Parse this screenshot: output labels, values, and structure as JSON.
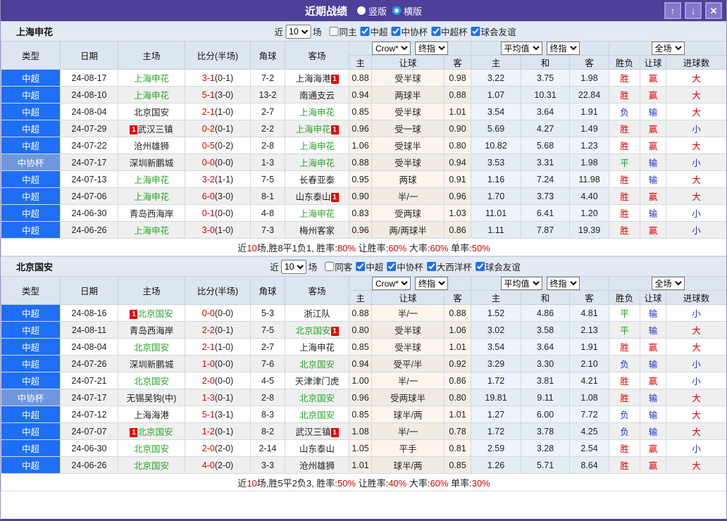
{
  "titlebar": {
    "title": "近期战绩",
    "radio_vertical": "竖版",
    "radio_horizontal": "横版",
    "up_glyph": "↑",
    "down_glyph": "↓",
    "close_glyph": "✕"
  },
  "colors": {
    "titlebar_bg": "#4c4099",
    "csl_type_bg": "#1e6ff5",
    "cup_type_bg": "#6f97df",
    "team_highlight_green": "#2ba52b",
    "score_red": "#e00000",
    "rank_badge_bg": "#e60000",
    "avg_col_bg": "#ecf5fb",
    "odds_col_bg": "#fdf5ec",
    "radio_ring_blue": "#1e9ce8"
  },
  "result_colors": {
    "胜": "#e00000",
    "平": "#1fa11f",
    "负": "#2233cc",
    "赢": "#e00000",
    "输": "#2233cc",
    "大": "#e00000",
    "小": "#2233cc"
  },
  "header": {
    "left_cols": [
      "类型",
      "日期",
      "主场",
      "比分(半场)",
      "角球",
      "客场"
    ],
    "sub_cols": [
      "主",
      "让球",
      "客",
      "主",
      "和",
      "客",
      "胜负",
      "让球",
      "进球数"
    ],
    "dropdowns": {
      "bookmaker": "Crow*",
      "odds_stage": "终指",
      "average": "平均值",
      "avg_stage": "终指",
      "scope": "全场"
    }
  },
  "sections": [
    {
      "team": "上海申花",
      "slug": "shenhua",
      "filter": {
        "near_label": "近",
        "near_value": "10",
        "games_label": "场",
        "same_label": "同主",
        "same_checked": false,
        "cups": [
          {
            "label": "中超",
            "checked": true
          },
          {
            "label": "中协杯",
            "checked": true
          },
          {
            "label": "中超杯",
            "checked": true
          },
          {
            "label": "球会友谊",
            "checked": true
          }
        ]
      },
      "rows": [
        {
          "type": "中超",
          "cup": false,
          "date": "24-08-17",
          "home": {
            "name": "上海申花",
            "green": true
          },
          "away": {
            "name": "上海海港",
            "green": false,
            "badge": "1",
            "badge_pos": "post"
          },
          "score": "3-1",
          "half": "(0-1)",
          "corners": "7-2",
          "odds": [
            "0.88",
            "受半球",
            "0.98"
          ],
          "avg": [
            "3.22",
            "3.75",
            "1.98"
          ],
          "results": [
            "胜",
            "赢",
            "大"
          ]
        },
        {
          "type": "中超",
          "cup": false,
          "date": "24-08-10",
          "home": {
            "name": "上海申花",
            "green": true
          },
          "away": {
            "name": "南通支云",
            "green": false
          },
          "score": "5-1",
          "half": "(3-0)",
          "corners": "13-2",
          "odds": [
            "0.94",
            "两球半",
            "0.88"
          ],
          "avg": [
            "1.07",
            "10.31",
            "22.84"
          ],
          "results": [
            "胜",
            "赢",
            "大"
          ]
        },
        {
          "type": "中超",
          "cup": false,
          "date": "24-08-04",
          "home": {
            "name": "北京国安",
            "green": false
          },
          "away": {
            "name": "上海申花",
            "green": true
          },
          "score": "2-1",
          "half": "(1-0)",
          "corners": "2-7",
          "odds": [
            "0.85",
            "受半球",
            "1.01"
          ],
          "avg": [
            "3.54",
            "3.64",
            "1.91"
          ],
          "results": [
            "负",
            "输",
            "大"
          ]
        },
        {
          "type": "中超",
          "cup": false,
          "date": "24-07-29",
          "home": {
            "name": "武汉三镇",
            "green": false,
            "badge": "1",
            "badge_pos": "pre"
          },
          "away": {
            "name": "上海申花",
            "green": true,
            "badge": "1",
            "badge_pos": "post"
          },
          "score": "0-2",
          "half": "(0-1)",
          "corners": "2-2",
          "odds": [
            "0.96",
            "受一球",
            "0.90"
          ],
          "avg": [
            "5.69",
            "4.27",
            "1.49"
          ],
          "results": [
            "胜",
            "赢",
            "小"
          ]
        },
        {
          "type": "中超",
          "cup": false,
          "date": "24-07-22",
          "home": {
            "name": "沧州雄狮",
            "green": false
          },
          "away": {
            "name": "上海申花",
            "green": true
          },
          "score": "0-5",
          "half": "(0-2)",
          "corners": "2-8",
          "odds": [
            "1.06",
            "受球半",
            "0.80"
          ],
          "avg": [
            "10.82",
            "5.68",
            "1.23"
          ],
          "results": [
            "胜",
            "赢",
            "大"
          ]
        },
        {
          "type": "中协杯",
          "cup": true,
          "date": "24-07-17",
          "home": {
            "name": "深圳新鹏城",
            "green": false
          },
          "away": {
            "name": "上海申花",
            "green": true
          },
          "score": "0-0",
          "half": "(0-0)",
          "corners": "1-3",
          "odds": [
            "0.88",
            "受半球",
            "0.94"
          ],
          "avg": [
            "3.53",
            "3.31",
            "1.98"
          ],
          "results": [
            "平",
            "输",
            "小"
          ]
        },
        {
          "type": "中超",
          "cup": false,
          "date": "24-07-13",
          "home": {
            "name": "上海申花",
            "green": true
          },
          "away": {
            "name": "长春亚泰",
            "green": false
          },
          "score": "3-2",
          "half": "(1-1)",
          "corners": "7-5",
          "odds": [
            "0.95",
            "两球",
            "0.91"
          ],
          "avg": [
            "1.16",
            "7.24",
            "11.98"
          ],
          "results": [
            "胜",
            "输",
            "大"
          ]
        },
        {
          "type": "中超",
          "cup": false,
          "date": "24-07-06",
          "home": {
            "name": "上海申花",
            "green": true
          },
          "away": {
            "name": "山东泰山",
            "green": false,
            "badge": "1",
            "badge_pos": "post"
          },
          "score": "6-0",
          "half": "(3-0)",
          "corners": "8-1",
          "odds": [
            "0.90",
            "半/一",
            "0.96"
          ],
          "avg": [
            "1.70",
            "3.73",
            "4.40"
          ],
          "results": [
            "胜",
            "赢",
            "大"
          ]
        },
        {
          "type": "中超",
          "cup": false,
          "date": "24-06-30",
          "home": {
            "name": "青岛西海岸",
            "green": false
          },
          "away": {
            "name": "上海申花",
            "green": true
          },
          "score": "0-1",
          "half": "(0-0)",
          "corners": "4-8",
          "odds": [
            "0.83",
            "受两球",
            "1.03"
          ],
          "avg": [
            "11.01",
            "6.41",
            "1.20"
          ],
          "results": [
            "胜",
            "输",
            "小"
          ]
        },
        {
          "type": "中超",
          "cup": false,
          "date": "24-06-26",
          "home": {
            "name": "上海申花",
            "green": true
          },
          "away": {
            "name": "梅州客家",
            "green": false
          },
          "score": "3-0",
          "half": "(1-0)",
          "corners": "7-3",
          "odds": [
            "0.96",
            "两/两球半",
            "0.86"
          ],
          "avg": [
            "1.11",
            "7.87",
            "19.39"
          ],
          "results": [
            "胜",
            "赢",
            "小"
          ]
        }
      ],
      "summary": [
        {
          "t": "近",
          "c": "k"
        },
        {
          "t": "10",
          "c": "r"
        },
        {
          "t": "场,胜8平1负1, 胜率:",
          "c": "k"
        },
        {
          "t": "80%",
          "c": "r"
        },
        {
          "t": " 让胜率:",
          "c": "k"
        },
        {
          "t": "60%",
          "c": "r"
        },
        {
          "t": " 大率:",
          "c": "k"
        },
        {
          "t": "60%",
          "c": "r"
        },
        {
          "t": " 单率:",
          "c": "k"
        },
        {
          "t": "50%",
          "c": "r"
        }
      ]
    },
    {
      "team": "北京国安",
      "slug": "guoan",
      "filter": {
        "near_label": "近",
        "near_value": "10",
        "games_label": "场",
        "same_label": "同客",
        "same_checked": false,
        "cups": [
          {
            "label": "中超",
            "checked": true
          },
          {
            "label": "中协杯",
            "checked": true
          },
          {
            "label": "大西洋杯",
            "checked": true
          },
          {
            "label": "球会友谊",
            "checked": true
          }
        ]
      },
      "rows": [
        {
          "type": "中超",
          "cup": false,
          "date": "24-08-16",
          "home": {
            "name": "北京国安",
            "green": true,
            "badge": "1",
            "badge_pos": "pre"
          },
          "away": {
            "name": "浙江队",
            "green": false
          },
          "score": "0-0",
          "half": "(0-0)",
          "corners": "5-3",
          "odds": [
            "0.88",
            "半/一",
            "0.88"
          ],
          "avg": [
            "1.52",
            "4.86",
            "4.81"
          ],
          "results": [
            "平",
            "输",
            "小"
          ]
        },
        {
          "type": "中超",
          "cup": false,
          "date": "24-08-11",
          "home": {
            "name": "青岛西海岸",
            "green": false
          },
          "away": {
            "name": "北京国安",
            "green": true,
            "badge": "1",
            "badge_pos": "post"
          },
          "score": "2-2",
          "half": "(0-1)",
          "corners": "7-5",
          "odds": [
            "0.80",
            "受半球",
            "1.06"
          ],
          "avg": [
            "3.02",
            "3.58",
            "2.13"
          ],
          "results": [
            "平",
            "输",
            "大"
          ]
        },
        {
          "type": "中超",
          "cup": false,
          "date": "24-08-04",
          "home": {
            "name": "北京国安",
            "green": true
          },
          "away": {
            "name": "上海申花",
            "green": false
          },
          "score": "2-1",
          "half": "(1-0)",
          "corners": "2-7",
          "odds": [
            "0.85",
            "受半球",
            "1.01"
          ],
          "avg": [
            "3.54",
            "3.64",
            "1.91"
          ],
          "results": [
            "胜",
            "赢",
            "大"
          ]
        },
        {
          "type": "中超",
          "cup": false,
          "date": "24-07-26",
          "home": {
            "name": "深圳新鹏城",
            "green": false
          },
          "away": {
            "name": "北京国安",
            "green": true
          },
          "score": "1-0",
          "half": "(0-0)",
          "corners": "7-6",
          "odds": [
            "0.94",
            "受平/半",
            "0.92"
          ],
          "avg": [
            "3.29",
            "3.30",
            "2.10"
          ],
          "results": [
            "负",
            "输",
            "小"
          ]
        },
        {
          "type": "中超",
          "cup": false,
          "date": "24-07-21",
          "home": {
            "name": "北京国安",
            "green": true
          },
          "away": {
            "name": "天津津门虎",
            "green": false
          },
          "score": "2-0",
          "half": "(0-0)",
          "corners": "4-5",
          "odds": [
            "1.00",
            "半/一",
            "0.86"
          ],
          "avg": [
            "1.72",
            "3.81",
            "4.21"
          ],
          "results": [
            "胜",
            "赢",
            "小"
          ]
        },
        {
          "type": "中协杯",
          "cup": true,
          "date": "24-07-17",
          "home": {
            "name": "无锡吴钩(中)",
            "green": false
          },
          "away": {
            "name": "北京国安",
            "green": true
          },
          "score": "1-3",
          "half": "(0-1)",
          "corners": "2-8",
          "odds": [
            "0.96",
            "受两球半",
            "0.80"
          ],
          "avg": [
            "19.81",
            "9.11",
            "1.08"
          ],
          "results": [
            "胜",
            "输",
            "大"
          ]
        },
        {
          "type": "中超",
          "cup": false,
          "date": "24-07-12",
          "home": {
            "name": "上海海港",
            "green": false
          },
          "away": {
            "name": "北京国安",
            "green": true
          },
          "score": "5-1",
          "half": "(3-1)",
          "corners": "8-3",
          "odds": [
            "0.85",
            "球半/两",
            "1.01"
          ],
          "avg": [
            "1.27",
            "6.00",
            "7.72"
          ],
          "results": [
            "负",
            "输",
            "大"
          ]
        },
        {
          "type": "中超",
          "cup": false,
          "date": "24-07-07",
          "home": {
            "name": "北京国安",
            "green": true,
            "badge": "1",
            "badge_pos": "pre"
          },
          "away": {
            "name": "武汉三镇",
            "green": false,
            "badge": "1",
            "badge_pos": "post"
          },
          "score": "1-2",
          "half": "(0-1)",
          "corners": "8-2",
          "odds": [
            "1.08",
            "半/一",
            "0.78"
          ],
          "avg": [
            "1.72",
            "3.78",
            "4.25"
          ],
          "results": [
            "负",
            "输",
            "大"
          ]
        },
        {
          "type": "中超",
          "cup": false,
          "date": "24-06-30",
          "home": {
            "name": "北京国安",
            "green": true
          },
          "away": {
            "name": "山东泰山",
            "green": false
          },
          "score": "2-0",
          "half": "(2-0)",
          "corners": "2-14",
          "odds": [
            "1.05",
            "平手",
            "0.81"
          ],
          "avg": [
            "2.59",
            "3.28",
            "2.54"
          ],
          "results": [
            "胜",
            "赢",
            "小"
          ]
        },
        {
          "type": "中超",
          "cup": false,
          "date": "24-06-26",
          "home": {
            "name": "北京国安",
            "green": true
          },
          "away": {
            "name": "沧州雄狮",
            "green": false
          },
          "score": "4-0",
          "half": "(2-0)",
          "corners": "3-3",
          "odds": [
            "1.01",
            "球半/两",
            "0.85"
          ],
          "avg": [
            "1.26",
            "5.71",
            "8.64"
          ],
          "results": [
            "胜",
            "赢",
            "大"
          ]
        }
      ],
      "summary": [
        {
          "t": "近",
          "c": "k"
        },
        {
          "t": "10",
          "c": "r"
        },
        {
          "t": "场,胜5平2负3, 胜率:",
          "c": "k"
        },
        {
          "t": "50%",
          "c": "r"
        },
        {
          "t": " 让胜率:",
          "c": "k"
        },
        {
          "t": "40%",
          "c": "r"
        },
        {
          "t": " 大率:",
          "c": "k"
        },
        {
          "t": "60%",
          "c": "r"
        },
        {
          "t": " 单率:",
          "c": "k"
        },
        {
          "t": "30%",
          "c": "r"
        }
      ]
    }
  ]
}
